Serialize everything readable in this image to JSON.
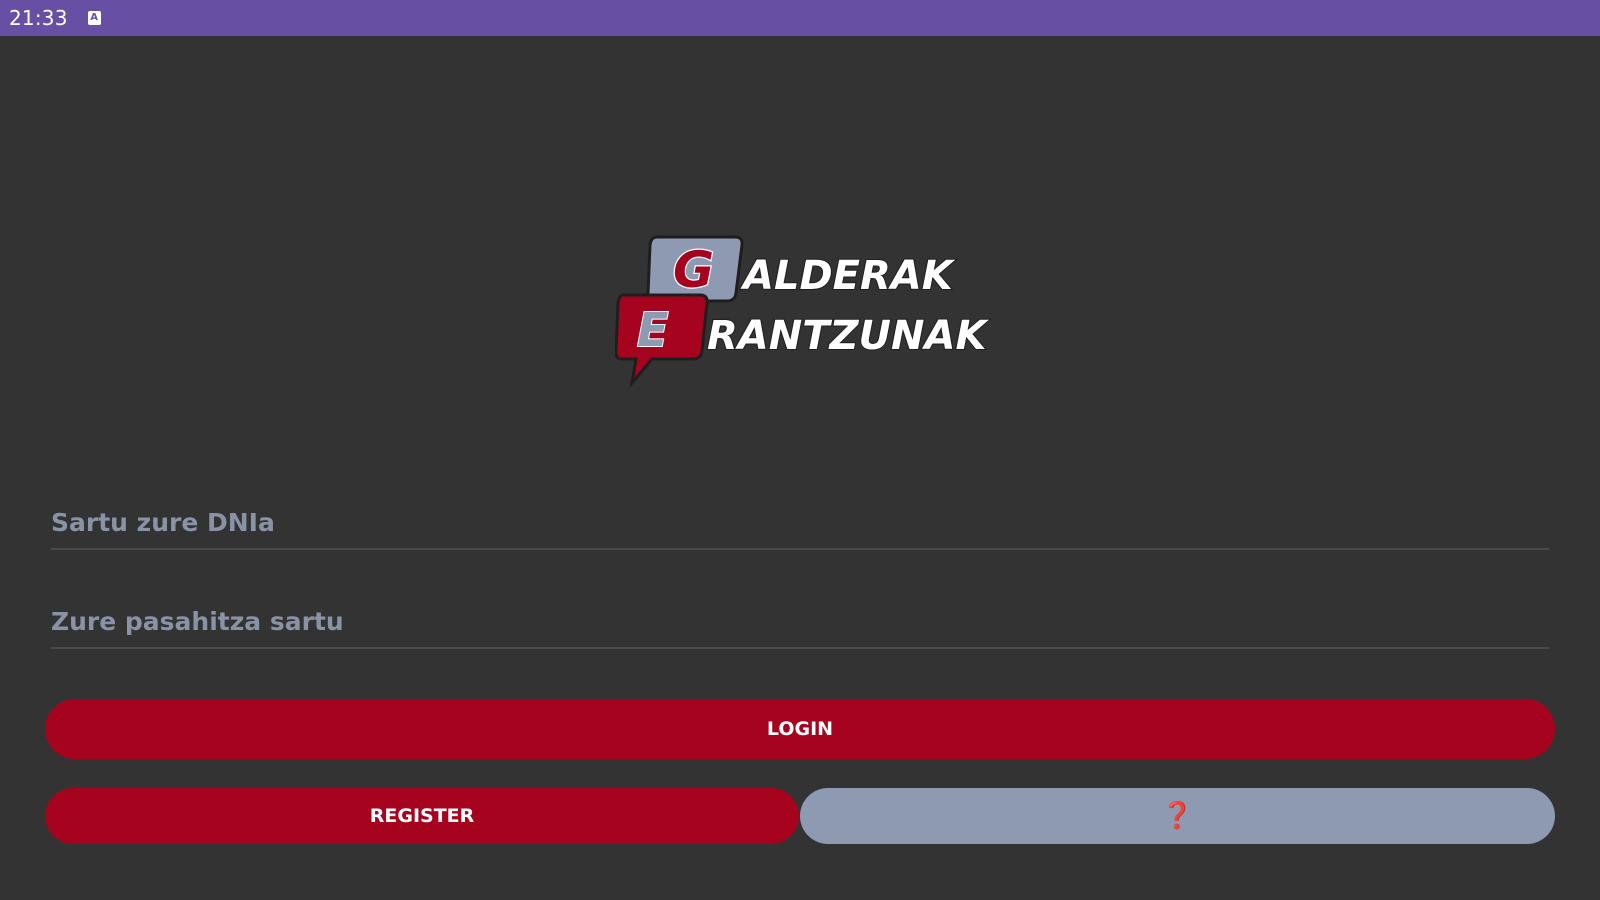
{
  "status_bar": {
    "time": "21:33",
    "notification_icon": "text-a-icon",
    "background_color": "#6750A4"
  },
  "logo": {
    "line1_letter": "G",
    "line1_rest": "ALDERAK",
    "line2_letter": "E",
    "line2_rest": "RANTZUNAK"
  },
  "form": {
    "dni_placeholder": "Sartu zure DNIa",
    "dni_value": "",
    "password_placeholder": "Zure pasahitza sartu",
    "password_value": ""
  },
  "buttons": {
    "login_label": "LOGIN",
    "register_label": "REGISTER",
    "help_label": "❓"
  },
  "colors": {
    "background": "#333333",
    "accent_red": "#A6041E",
    "secondary_blue_gray": "#8D9AB2"
  }
}
